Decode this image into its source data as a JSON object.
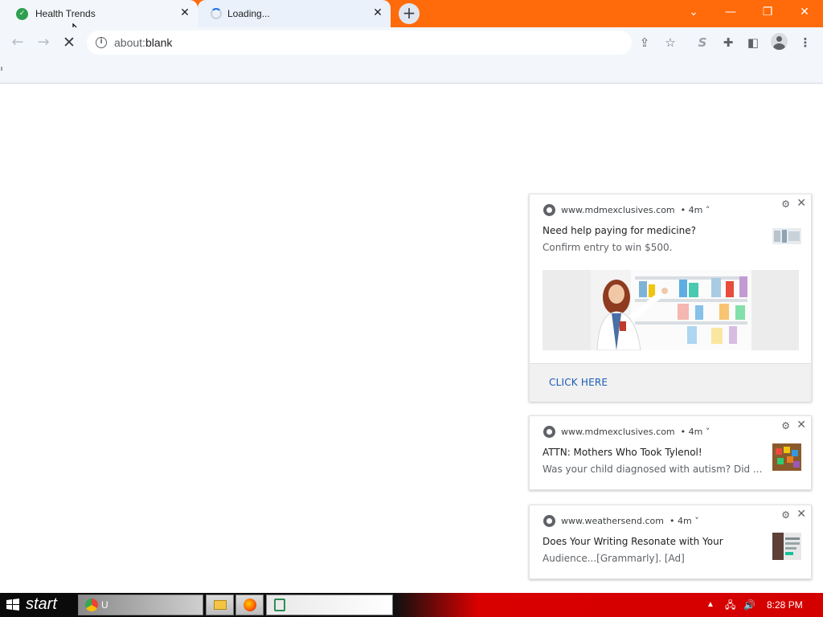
{
  "browser": {
    "tabs": [
      {
        "title": "Health Trends",
        "favicon": "shield-check-icon",
        "active": true
      },
      {
        "title": "Loading...",
        "favicon": "loading-spinner-icon",
        "active": false
      }
    ],
    "new_tab_symbol": "+",
    "close_symbol": "✕",
    "url": {
      "scheme": "about:",
      "host": "blank"
    },
    "theme_color": "#ff6b0b"
  },
  "notifications": [
    {
      "origin": "www.mdmexclusives.com",
      "age": "4m",
      "expand_state": "expanded",
      "title": "Need help paying for medicine?",
      "body": "Confirm entry to win $500.",
      "image": "pharmacist-photo",
      "action": "CLICK HERE"
    },
    {
      "origin": "www.mdmexclusives.com",
      "age": "4m",
      "expand_state": "collapsed",
      "title": "ATTN: Mothers Who Took Tylenol!",
      "body": "Was your child diagnosed with autism? Did ..."
    },
    {
      "origin": "www.weathersend.com",
      "age": "4m",
      "expand_state": "collapsed",
      "title": "Does Your Writing Resonate with Your",
      "body": "Audience...[Grammarly].   [Ad]"
    }
  ],
  "taskbar": {
    "start_label": "start",
    "buttons": [
      {
        "label": "U",
        "icon": "chrome-icon"
      },
      {
        "label": "",
        "icon": "folder-icon"
      },
      {
        "label": "",
        "icon": "firefox-icon"
      },
      {
        "label": "",
        "icon": "recycle-icon"
      }
    ],
    "clock": "8:28 PM"
  }
}
